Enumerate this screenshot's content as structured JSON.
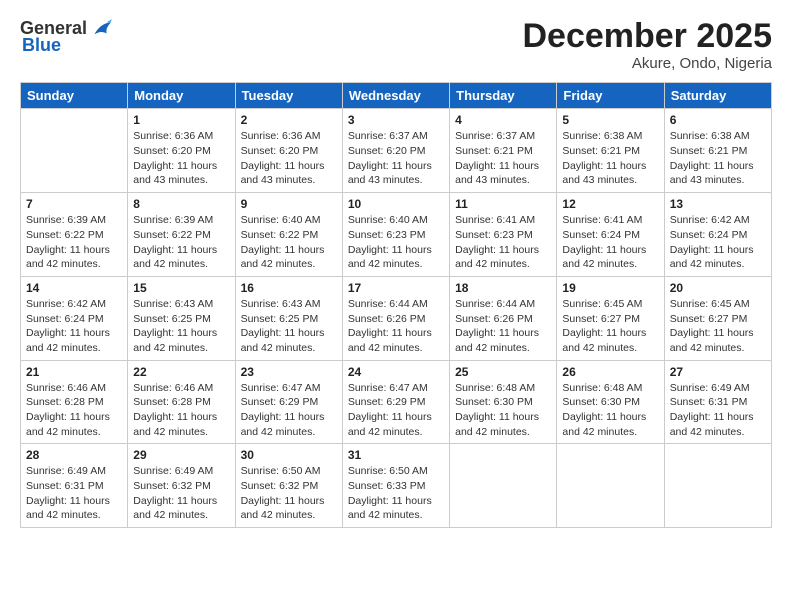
{
  "logo": {
    "general": "General",
    "blue": "Blue"
  },
  "header": {
    "month_year": "December 2025",
    "location": "Akure, Ondo, Nigeria"
  },
  "days": [
    "Sunday",
    "Monday",
    "Tuesday",
    "Wednesday",
    "Thursday",
    "Friday",
    "Saturday"
  ],
  "weeks": [
    [
      {
        "day": "",
        "sunrise": "",
        "sunset": "",
        "daylight": ""
      },
      {
        "day": "1",
        "sunrise": "6:36 AM",
        "sunset": "6:20 PM",
        "daylight": "11 hours and 43 minutes."
      },
      {
        "day": "2",
        "sunrise": "6:36 AM",
        "sunset": "6:20 PM",
        "daylight": "11 hours and 43 minutes."
      },
      {
        "day": "3",
        "sunrise": "6:37 AM",
        "sunset": "6:20 PM",
        "daylight": "11 hours and 43 minutes."
      },
      {
        "day": "4",
        "sunrise": "6:37 AM",
        "sunset": "6:21 PM",
        "daylight": "11 hours and 43 minutes."
      },
      {
        "day": "5",
        "sunrise": "6:38 AM",
        "sunset": "6:21 PM",
        "daylight": "11 hours and 43 minutes."
      },
      {
        "day": "6",
        "sunrise": "6:38 AM",
        "sunset": "6:21 PM",
        "daylight": "11 hours and 43 minutes."
      }
    ],
    [
      {
        "day": "7",
        "sunrise": "6:39 AM",
        "sunset": "6:22 PM",
        "daylight": "11 hours and 42 minutes."
      },
      {
        "day": "8",
        "sunrise": "6:39 AM",
        "sunset": "6:22 PM",
        "daylight": "11 hours and 42 minutes."
      },
      {
        "day": "9",
        "sunrise": "6:40 AM",
        "sunset": "6:22 PM",
        "daylight": "11 hours and 42 minutes."
      },
      {
        "day": "10",
        "sunrise": "6:40 AM",
        "sunset": "6:23 PM",
        "daylight": "11 hours and 42 minutes."
      },
      {
        "day": "11",
        "sunrise": "6:41 AM",
        "sunset": "6:23 PM",
        "daylight": "11 hours and 42 minutes."
      },
      {
        "day": "12",
        "sunrise": "6:41 AM",
        "sunset": "6:24 PM",
        "daylight": "11 hours and 42 minutes."
      },
      {
        "day": "13",
        "sunrise": "6:42 AM",
        "sunset": "6:24 PM",
        "daylight": "11 hours and 42 minutes."
      }
    ],
    [
      {
        "day": "14",
        "sunrise": "6:42 AM",
        "sunset": "6:24 PM",
        "daylight": "11 hours and 42 minutes."
      },
      {
        "day": "15",
        "sunrise": "6:43 AM",
        "sunset": "6:25 PM",
        "daylight": "11 hours and 42 minutes."
      },
      {
        "day": "16",
        "sunrise": "6:43 AM",
        "sunset": "6:25 PM",
        "daylight": "11 hours and 42 minutes."
      },
      {
        "day": "17",
        "sunrise": "6:44 AM",
        "sunset": "6:26 PM",
        "daylight": "11 hours and 42 minutes."
      },
      {
        "day": "18",
        "sunrise": "6:44 AM",
        "sunset": "6:26 PM",
        "daylight": "11 hours and 42 minutes."
      },
      {
        "day": "19",
        "sunrise": "6:45 AM",
        "sunset": "6:27 PM",
        "daylight": "11 hours and 42 minutes."
      },
      {
        "day": "20",
        "sunrise": "6:45 AM",
        "sunset": "6:27 PM",
        "daylight": "11 hours and 42 minutes."
      }
    ],
    [
      {
        "day": "21",
        "sunrise": "6:46 AM",
        "sunset": "6:28 PM",
        "daylight": "11 hours and 42 minutes."
      },
      {
        "day": "22",
        "sunrise": "6:46 AM",
        "sunset": "6:28 PM",
        "daylight": "11 hours and 42 minutes."
      },
      {
        "day": "23",
        "sunrise": "6:47 AM",
        "sunset": "6:29 PM",
        "daylight": "11 hours and 42 minutes."
      },
      {
        "day": "24",
        "sunrise": "6:47 AM",
        "sunset": "6:29 PM",
        "daylight": "11 hours and 42 minutes."
      },
      {
        "day": "25",
        "sunrise": "6:48 AM",
        "sunset": "6:30 PM",
        "daylight": "11 hours and 42 minutes."
      },
      {
        "day": "26",
        "sunrise": "6:48 AM",
        "sunset": "6:30 PM",
        "daylight": "11 hours and 42 minutes."
      },
      {
        "day": "27",
        "sunrise": "6:49 AM",
        "sunset": "6:31 PM",
        "daylight": "11 hours and 42 minutes."
      }
    ],
    [
      {
        "day": "28",
        "sunrise": "6:49 AM",
        "sunset": "6:31 PM",
        "daylight": "11 hours and 42 minutes."
      },
      {
        "day": "29",
        "sunrise": "6:49 AM",
        "sunset": "6:32 PM",
        "daylight": "11 hours and 42 minutes."
      },
      {
        "day": "30",
        "sunrise": "6:50 AM",
        "sunset": "6:32 PM",
        "daylight": "11 hours and 42 minutes."
      },
      {
        "day": "31",
        "sunrise": "6:50 AM",
        "sunset": "6:33 PM",
        "daylight": "11 hours and 42 minutes."
      },
      {
        "day": "",
        "sunrise": "",
        "sunset": "",
        "daylight": ""
      },
      {
        "day": "",
        "sunrise": "",
        "sunset": "",
        "daylight": ""
      },
      {
        "day": "",
        "sunrise": "",
        "sunset": "",
        "daylight": ""
      }
    ]
  ]
}
